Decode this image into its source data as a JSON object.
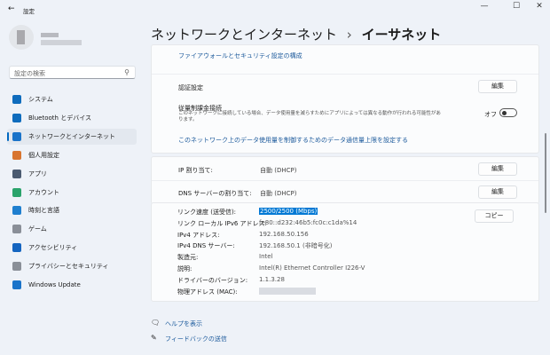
{
  "titlebar": {
    "back": "←",
    "title": "設定",
    "minimize": "—",
    "maximize": "☐",
    "close": "✕"
  },
  "sidebar": {
    "search_placeholder": "設定の検索",
    "search_icon": "⚲",
    "items": [
      {
        "label": "システム",
        "color": "#0f6cbd"
      },
      {
        "label": "Bluetooth とデバイス",
        "color": "#0f6cbd"
      },
      {
        "label": "ネットワークとインターネット",
        "color": "#1a73c9"
      },
      {
        "label": "個人用設定",
        "color": "#d8752f"
      },
      {
        "label": "アプリ",
        "color": "#4a5a70"
      },
      {
        "label": "アカウント",
        "color": "#2aa36b"
      },
      {
        "label": "時刻と言語",
        "color": "#1f7fcf"
      },
      {
        "label": "ゲーム",
        "color": "#8a8f98"
      },
      {
        "label": "アクセシビリティ",
        "color": "#1565c0"
      },
      {
        "label": "プライバシーとセキュリティ",
        "color": "#8a8f98"
      },
      {
        "label": "Windows Update",
        "color": "#1a73c9"
      }
    ],
    "selected": 2
  },
  "header": {
    "breadcrumb_parent": "ネットワークとインターネット",
    "separator": "›",
    "title": "イーサネット"
  },
  "firewall_link": "ファイアウォールとセキュリティ設定の構成",
  "auth": {
    "label": "認証設定",
    "button": "編集"
  },
  "metered": {
    "label": "従量制課金接続",
    "desc": "このネットワークに接続している場合、データ使用量を減らすためにアプリによっては異なる動作が行われる可能性があります。",
    "state": "オフ",
    "on": false
  },
  "data_limit_link": "このネットワーク上のデータ使用量を制御するためのデータ通信量上限を設定する",
  "ip": {
    "label": "IP 割り当て:",
    "value": "自動 (DHCP)",
    "button": "編集"
  },
  "dns": {
    "label": "DNS サーバーの割り当て:",
    "value": "自動 (DHCP)",
    "button": "編集"
  },
  "details": {
    "copy_button": "コピー",
    "rows": [
      {
        "label": "リンク速度 (送受信):",
        "value": "2500/2500 (Mbps)"
      },
      {
        "label": "リンク ローカル IPv6 アドレス:",
        "value": "fe80::d232:46b5:fc0c:c1da%14"
      },
      {
        "label": "IPv4 アドレス:",
        "value": "192.168.50.156"
      },
      {
        "label": "IPv4 DNS サーバー:",
        "value": "192.168.50.1 (非暗号化)"
      },
      {
        "label": "製造元:",
        "value": "Intel"
      },
      {
        "label": "説明:",
        "value": "Intel(R) Ethernet Controller I226-V"
      },
      {
        "label": "ドライバーのバージョン:",
        "value": "1.1.3.28"
      },
      {
        "label": "物理アドレス (MAC):",
        "value": ""
      }
    ]
  },
  "footer": {
    "help": "ヘルプを表示",
    "feedback": "フィードバックの送信"
  }
}
